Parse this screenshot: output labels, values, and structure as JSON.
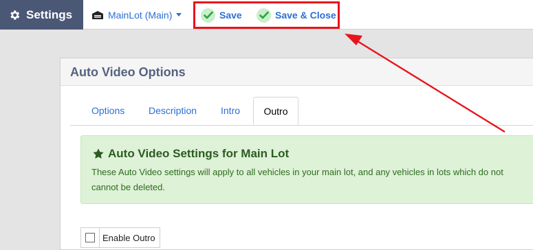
{
  "topbar": {
    "brand_label": "Settings",
    "brand_icon": "gear-icon",
    "lot_selector_label": "MainLot (Main)",
    "save_label": "Save",
    "save_close_label": "Save & Close"
  },
  "panel": {
    "title": "Auto Video Options",
    "tabs": [
      {
        "label": "Options",
        "active": false
      },
      {
        "label": "Description",
        "active": false
      },
      {
        "label": "Intro",
        "active": false
      },
      {
        "label": "Outro",
        "active": true
      }
    ]
  },
  "alert": {
    "title": "Auto Video Settings for Main Lot",
    "line1": "These Auto Video settings will apply to all vehicles in your main lot, and any vehicles in lots which do not",
    "line2": "cannot be deleted."
  },
  "outro": {
    "enable_label": "Enable Outro",
    "enabled": false
  },
  "annotation": {
    "highlight_color": "#e8141c"
  }
}
